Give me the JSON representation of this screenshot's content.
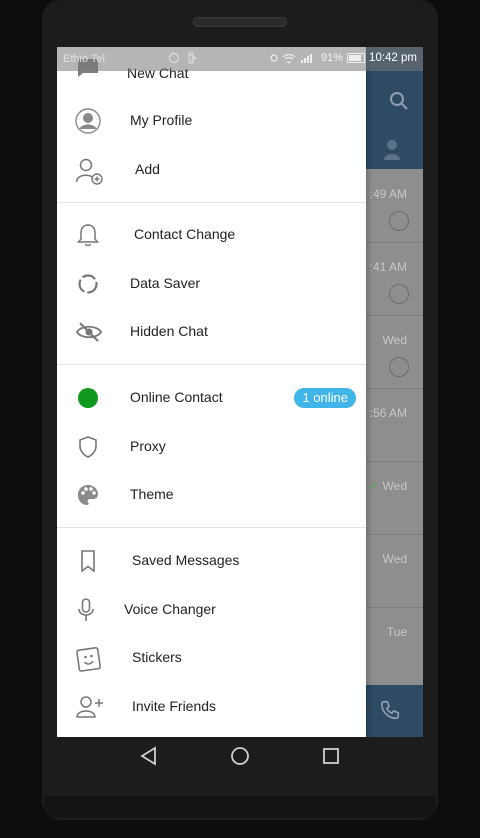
{
  "status_bar": {
    "carrier": "Ethio Tel",
    "battery": "91%",
    "time": "10:42 pm"
  },
  "background": {
    "rows": [
      {
        "time": ":49 AM"
      },
      {
        "time": ":41 AM"
      },
      {
        "time": "Wed"
      },
      {
        "time": ":56 AM"
      },
      {
        "time": "Wed"
      },
      {
        "time": "Wed"
      },
      {
        "time": "Tue"
      }
    ]
  },
  "drawer": {
    "new_chat": "New Chat",
    "my_profile": "My Profile",
    "add": "Add",
    "contact_change": "Contact Change",
    "data_saver": "Data Saver",
    "hidden_chat": "Hidden Chat",
    "online_contact": "Online Contact",
    "online_badge": "1 online",
    "proxy": "Proxy",
    "theme": "Theme",
    "saved_messages": "Saved Messages",
    "voice_changer": "Voice Changer",
    "stickers": "Stickers",
    "invite_friends": "Invite Friends"
  },
  "colors": {
    "header": "#2f4a63",
    "badge": "#3fb5e9",
    "online_dot": "#0f9a1e"
  }
}
